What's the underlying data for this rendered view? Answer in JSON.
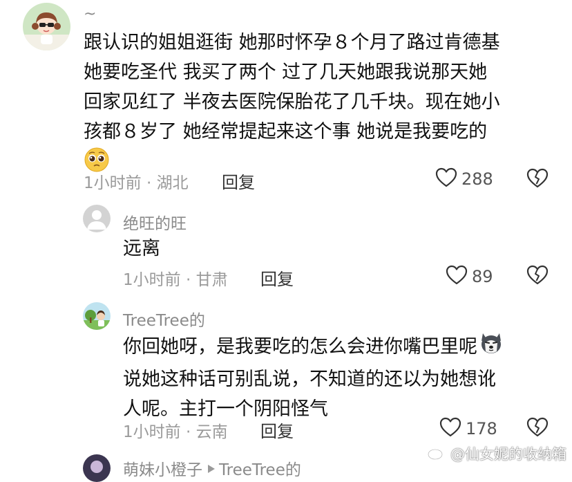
{
  "comments": [
    {
      "username": "~",
      "lines": [
        "跟认识的姐姐逛街 她那时怀孕８个月了路过肯德基",
        "她要吃圣代 我买了两个 过了几天她跟我说那天她",
        "回家见红了 半夜去医院保胎花了几千块。现在她小",
        "孩都８岁了 她经常提起来这个事 她说是我要吃的"
      ],
      "time_location": "1小时前 · 湖北",
      "reply_label": "回复",
      "likes": "288"
    },
    {
      "username": "绝旺的旺",
      "lines": [
        "远离"
      ],
      "time_location": "1小时前 · 甘肃",
      "reply_label": "回复",
      "likes": "89"
    },
    {
      "username": "TreeTree的",
      "lines": [
        "你回她呀，是我要吃的怎么会进你嘴巴里呢",
        "说她这种话可别乱说，不知道的还以为她想讹",
        "人呢。主打一个阴阳怪气"
      ],
      "time_location": "1小时前 · 云南",
      "reply_label": "回复",
      "likes": "178"
    },
    {
      "username": "萌妹小橙子",
      "reply_to": "TreeTree的"
    }
  ],
  "watermark": "@仙女妮的收纳箱",
  "icons": {
    "like": "heart-outline-icon",
    "dislike": "broken-heart-icon",
    "pleading_emoji": "pleading-face-emoji",
    "husky_emoji": "husky-face-emoji",
    "reply_arrow": "triangle-right-icon",
    "weibo": "weibo-logo-icon"
  }
}
